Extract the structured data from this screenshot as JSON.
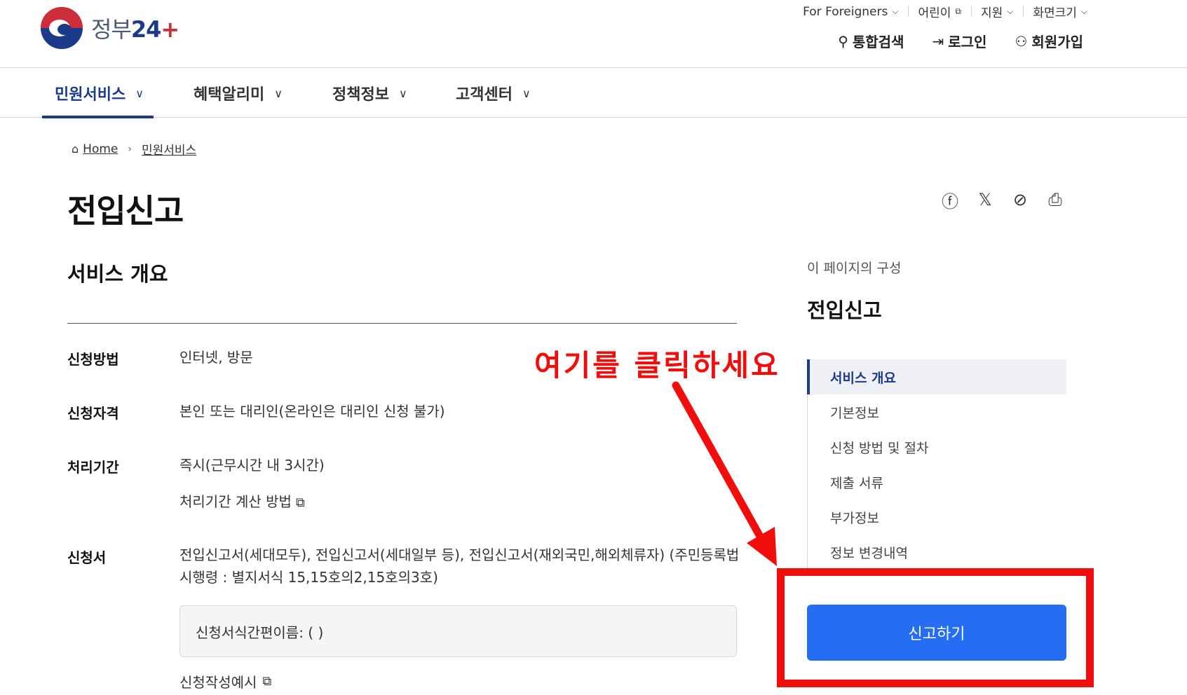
{
  "header": {
    "logo_text": "정부",
    "logo_num": "24",
    "util": [
      {
        "label": "For Foreigners",
        "icon": "chevron-down-icon"
      },
      {
        "label": "어린이",
        "icon": "external-link-icon"
      },
      {
        "label": "지원",
        "icon": "chevron-down-icon"
      },
      {
        "label": "화면크기",
        "icon": "chevron-down-icon"
      }
    ],
    "actions": [
      {
        "label": "통합검색",
        "icon": "search-icon"
      },
      {
        "label": "로그인",
        "icon": "login-icon"
      },
      {
        "label": "회원가입",
        "icon": "user-plus-icon"
      }
    ]
  },
  "nav": {
    "items": [
      {
        "label": "민원서비스",
        "active": true
      },
      {
        "label": "혜택알리미"
      },
      {
        "label": "정책정보"
      },
      {
        "label": "고객센터"
      }
    ]
  },
  "breadcrumb": {
    "home": "Home",
    "current": "민원서비스"
  },
  "page": {
    "title": "전입신고",
    "section_title": "서비스 개요"
  },
  "share": [
    "facebook-icon",
    "x-icon",
    "paperclip-icon",
    "print-icon"
  ],
  "overview": {
    "method_label": "신청방법",
    "method_value": "인터넷, 방문",
    "qualification_label": "신청자격",
    "qualification_value": "본인 또는 대리인(온라인은 대리인 신청 불가)",
    "period_label": "처리기간",
    "period_value": "즉시(근무시간 내 3시간)",
    "period_link": "처리기간 계산 방법",
    "form_label": "신청서",
    "form_value_line1": "전입신고서(세대모두), 전입신고서(세대일부 등), 전입신고서(재외국민,해외체류자) (주민등록법",
    "form_value_line2": "시행령 : 별지서식 15,15호의2,15호의3호)",
    "form_box": "신청서식간편이름: ( )",
    "example_link": "신청작성예시"
  },
  "toc": {
    "caption": "이 페이지의 구성",
    "title": "전입신고",
    "items": [
      {
        "label": "서비스 개요",
        "active": true
      },
      {
        "label": "기본정보"
      },
      {
        "label": "신청 방법 및 절차"
      },
      {
        "label": "제출 서류"
      },
      {
        "label": "부가정보"
      },
      {
        "label": "정보 변경내역"
      }
    ],
    "apply_button": "신고하기"
  },
  "annotation": {
    "text": "여기를 클릭하세요",
    "color": "#f20d0d"
  },
  "colors": {
    "primary": "#1b3a8a",
    "button": "#256ef4"
  }
}
